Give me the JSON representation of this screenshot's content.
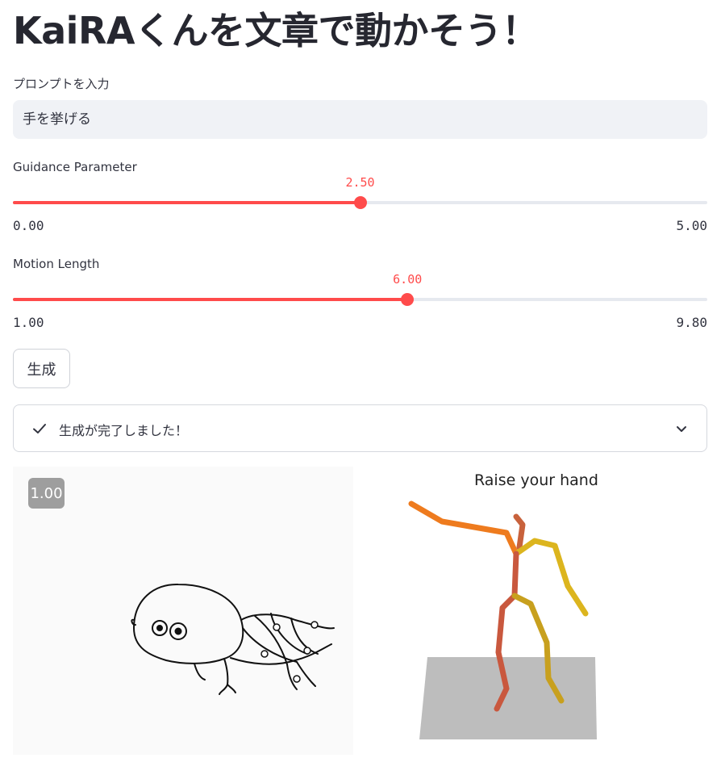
{
  "page": {
    "title": "KaiRAくんを文章で動かそう！"
  },
  "prompt": {
    "label": "プロンプトを入力",
    "value": "手を挙げる"
  },
  "guidance": {
    "label": "Guidance Parameter",
    "value_text": "2.50",
    "min_text": "0.00",
    "max_text": "5.00",
    "value": 2.5,
    "min": 0,
    "max": 5
  },
  "motion_length": {
    "label": "Motion Length",
    "value_text": "6.00",
    "min_text": "1.00",
    "max_text": "9.80",
    "value": 6.0,
    "min": 1,
    "max": 9.8
  },
  "generate_button": {
    "label": "生成"
  },
  "status": {
    "text": "生成が完了しました！",
    "check_icon": "check-icon",
    "chevron_icon": "chevron-down-icon"
  },
  "video": {
    "speed_badge": "1.00"
  },
  "animation": {
    "caption": "Raise your hand"
  },
  "colors": {
    "accent": "#ff4b4b",
    "track": "#e6e9ef",
    "input_bg": "#f0f2f6"
  }
}
